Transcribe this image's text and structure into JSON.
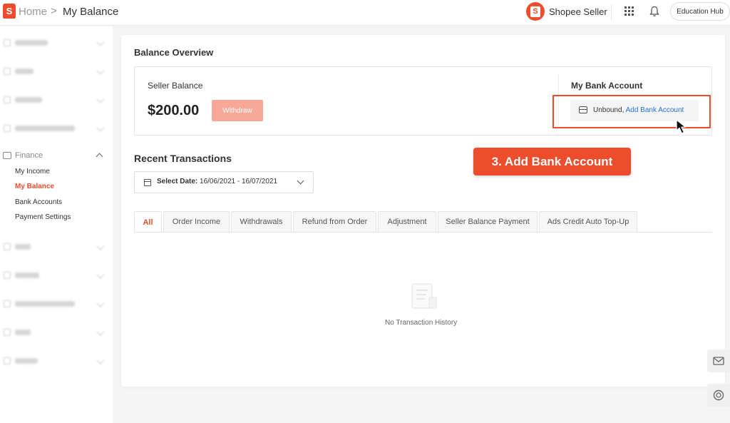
{
  "header": {
    "logo_glyph": "S",
    "breadcrumb_home": "Home",
    "breadcrumb_sep": ">",
    "breadcrumb_current": "My Balance",
    "seller_logo_glyph": "S",
    "seller_name": "Shopee Seller",
    "education_hub": "Education Hub"
  },
  "sidebar": {
    "finance_label": "Finance",
    "finance_sub": [
      {
        "label": "My Income",
        "active": false
      },
      {
        "label": "My Balance",
        "active": true
      },
      {
        "label": "Bank Accounts",
        "active": false
      },
      {
        "label": "Payment Settings",
        "active": false
      }
    ]
  },
  "balance": {
    "overview_title": "Balance Overview",
    "seller_balance_label": "Seller Balance",
    "amount": "$200.00",
    "withdraw_label": "Withdraw",
    "bank_title": "My Bank Account",
    "bank_status": "Unbound,",
    "add_bank_link": "Add Bank Account"
  },
  "transactions": {
    "title": "Recent Transactions",
    "date_prefix": "Select Date:",
    "date_range": "16/06/2021 - 16/07/2021",
    "tabs": [
      "All",
      "Order Income",
      "Withdrawals",
      "Refund from Order",
      "Adjustment",
      "Seller Balance Payment",
      "Ads Credit Auto Top-Up"
    ],
    "empty_text": "No Transaction History"
  },
  "callout": {
    "text": "3. Add Bank Account"
  },
  "colors": {
    "accent": "#ee4d2d",
    "link": "#2673dd",
    "withdraw_disabled": "#f7a898"
  }
}
